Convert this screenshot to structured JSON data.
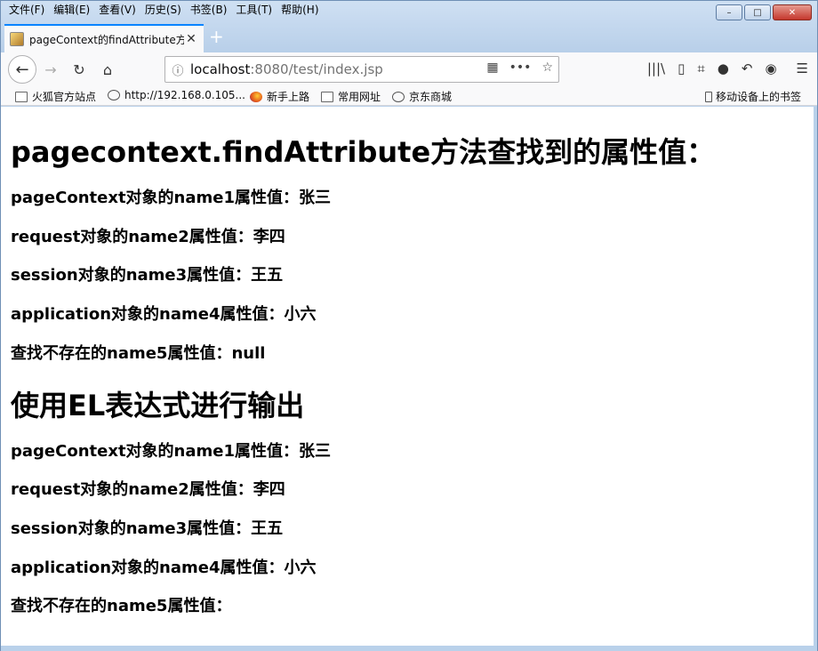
{
  "menubar": {
    "items": [
      "文件(F)",
      "编辑(E)",
      "查看(V)",
      "历史(S)",
      "书签(B)",
      "工具(T)",
      "帮助(H)"
    ]
  },
  "tab": {
    "title": "pageContext的findAttribute方",
    "close_glyph": "✕",
    "new_tab_glyph": "+"
  },
  "window_controls": {
    "minimize": "–",
    "maximize": "□",
    "close": "✕"
  },
  "navbar": {
    "back_glyph": "←",
    "forward_glyph": "→",
    "reload_glyph": "↻",
    "home_glyph": "⌂",
    "url_host": "localhost",
    "url_rest": ":8080/test/index.jsp",
    "info_glyph": "ⓘ",
    "qr_glyph": "▦",
    "more_glyph": "•••",
    "star_glyph": "☆",
    "library_glyph": "|||\\",
    "sidebar_glyph": "▯",
    "crop_glyph": "⌗",
    "chat_glyph": "●",
    "undo_glyph": "↶",
    "account_glyph": "◉",
    "menu_glyph": "☰"
  },
  "bookmarks": {
    "items": [
      "火狐官方站点",
      "http://192.168.0.105...",
      "新手上路",
      "常用网址",
      "京东商城"
    ],
    "mobile": "移动设备上的书签"
  },
  "page": {
    "heading1": "pagecontext.findAttribute方法查找到的属性值：",
    "section1": [
      "pageContext对象的name1属性值：张三",
      "request对象的name2属性值：李四",
      "session对象的name3属性值：王五",
      "application对象的name4属性值：小六",
      "查找不存在的name5属性值：null"
    ],
    "heading2": "使用EL表达式进行输出",
    "section2": [
      "pageContext对象的name1属性值：张三",
      "request对象的name2属性值：李四",
      "session对象的name3属性值：王五",
      "application对象的name4属性值：小六",
      "查找不存在的name5属性值："
    ]
  }
}
